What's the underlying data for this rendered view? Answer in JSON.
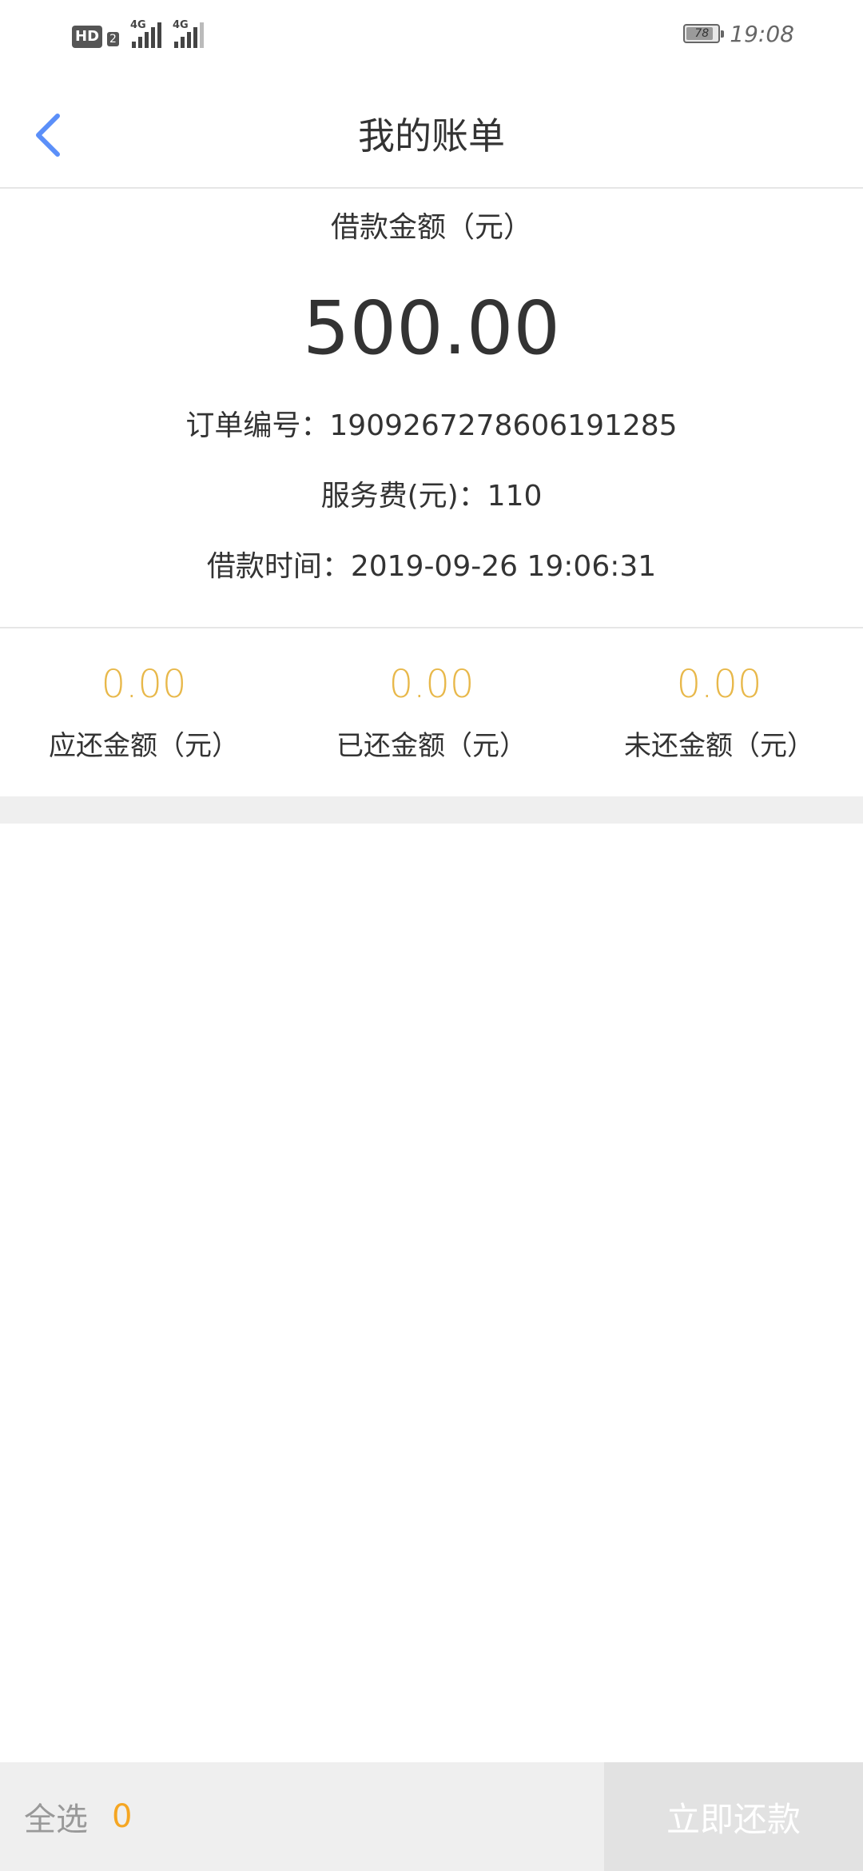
{
  "status_bar": {
    "hd_label": "HD",
    "hd_sub": "2",
    "signal1_label": "4G",
    "signal2_label": "4G",
    "battery_level": "78",
    "time": "19:08"
  },
  "nav": {
    "title": "我的账单",
    "back_icon": "chevron-left-icon",
    "accent_color": "#5b8ff9"
  },
  "loan": {
    "amount_label": "借款金额（元）",
    "amount": "500.00",
    "order_number": "订单编号：1909267278606191285",
    "service_fee": "服务费(元)：110",
    "loan_time": "借款时间：2019-09-26 19:06:31"
  },
  "summary": {
    "value_color": "#e8b84a",
    "items": [
      {
        "value": "0.00",
        "label": "应还金额（元）"
      },
      {
        "value": "0.00",
        "label": "已还金额（元）"
      },
      {
        "value": "0.00",
        "label": "未还金额（元）"
      }
    ]
  },
  "bottom_bar": {
    "select_all_label": "全选",
    "selected_count": "0",
    "repay_button_label": "立即还款"
  }
}
